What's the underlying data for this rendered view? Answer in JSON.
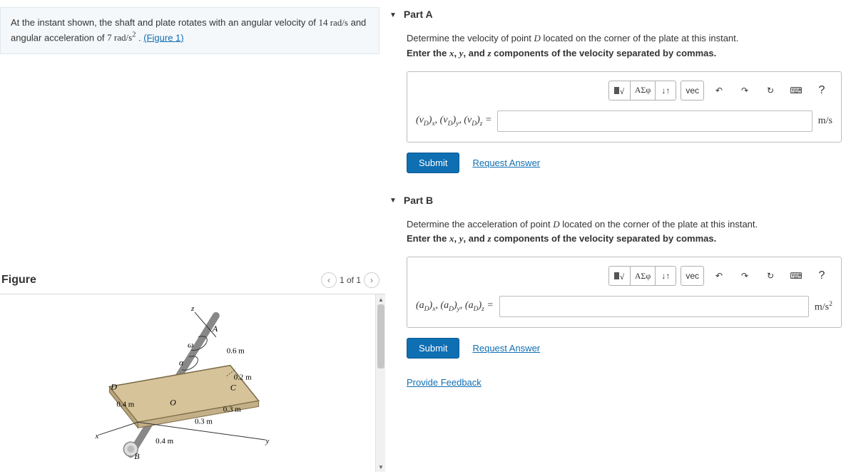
{
  "problem": {
    "text_prefix": "At the instant shown, the shaft and plate rotates with an angular velocity of ",
    "omega_val": "14 rad/s",
    "text_mid": " and angular acceleration of ",
    "alpha_val": "7 rad/s",
    "text_suffix": " . ",
    "figure_link": "(Figure 1)",
    "squared": "2"
  },
  "figure": {
    "title": "Figure",
    "pager": "1 of 1",
    "labels": {
      "A": "A",
      "B": "B",
      "C": "C",
      "D": "D",
      "O": "O",
      "d06": "0.6 m",
      "d02": "0.2 m",
      "d03a": "0.3 m",
      "d03b": "0.3 m",
      "d04a": "0.4 m",
      "d04b": "0.4 m",
      "x": "x",
      "y": "y",
      "z": "z",
      "omega": "ω",
      "alpha": "α"
    }
  },
  "partA": {
    "title": "Part A",
    "line1_pre": "Determine the velocity of point ",
    "line1_mid": "D",
    "line1_post": " located on the corner of the plate at this instant.",
    "line2_pre": "Enter the ",
    "xvar": "x",
    "yvar": "y",
    "zvar": "z",
    "line2_mid1": ", ",
    "line2_mid2": ", and ",
    "line2_post": " components of the velocity separated by commas.",
    "expr_label_html": "(v_D)_x, (v_D)_y, (v_D)_z =",
    "unit": "m/s",
    "submit": "Submit",
    "request": "Request Answer"
  },
  "partB": {
    "title": "Part B",
    "line1_pre": "Determine the acceleration of point ",
    "line1_mid": "D",
    "line1_post": " located on the corner of the plate at this instant.",
    "line2_pre": "Enter the ",
    "xvar": "x",
    "yvar": "y",
    "zvar": "z",
    "line2_mid1": ", ",
    "line2_mid2": ", and ",
    "line2_post": " components of the velocity separated by commas.",
    "unit_base": "m/s",
    "unit_exp": "2",
    "submit": "Submit",
    "request": "Request Answer"
  },
  "toolbar": {
    "templates": "▮√",
    "greek": "ΑΣφ",
    "subsup": "↓↑",
    "vec": "vec",
    "undo": "↶",
    "redo": "↷",
    "reset": "↻",
    "keyboard": "⌨",
    "help": "?"
  },
  "feedback": "Provide Feedback"
}
